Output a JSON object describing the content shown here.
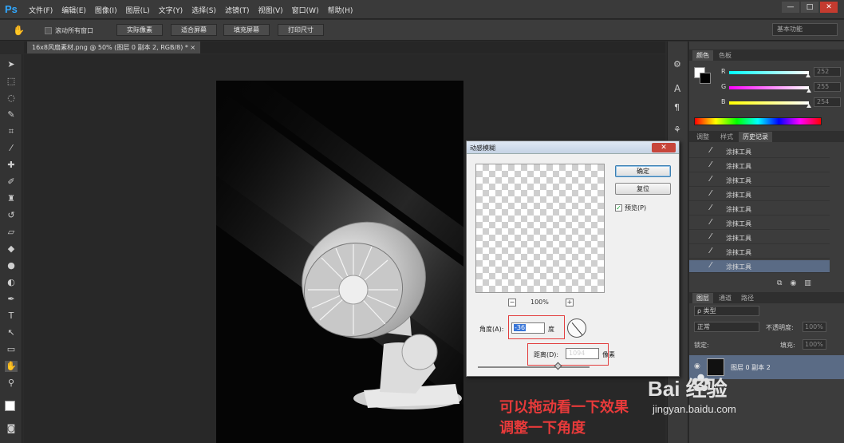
{
  "app": {
    "logo": "Ps"
  },
  "menu": [
    "文件(F)",
    "编辑(E)",
    "图像(I)",
    "图层(L)",
    "文字(Y)",
    "选择(S)",
    "滤镜(T)",
    "视图(V)",
    "窗口(W)",
    "帮助(H)"
  ],
  "window_controls": {
    "minimize": "—",
    "restore": "□",
    "close": "✕"
  },
  "options": {
    "scroll_all": "滚动所有窗口",
    "buttons": [
      "实际像素",
      "适合屏幕",
      "填充屏幕",
      "打印尺寸"
    ],
    "workspace": "基本功能"
  },
  "document_tab": "16x8风扇素材.png @ 50% (图层 0 副本 2, RGB/8) * ×",
  "panels": {
    "color_tabs": [
      "颜色",
      "色板"
    ],
    "sliders": [
      {
        "label": "R",
        "value": "252",
        "color": "#c8d8e8",
        "fill": 0.99
      },
      {
        "label": "G",
        "value": "255",
        "color": "#d6d6d6",
        "fill": 1.0
      },
      {
        "label": "B",
        "value": "254",
        "color": "#e6e6b8",
        "fill": 0.996
      }
    ],
    "history_tabs": [
      "调整",
      "样式",
      "历史记录"
    ],
    "history_items": [
      "涂抹工具",
      "涂抹工具",
      "涂抹工具",
      "涂抹工具",
      "涂抹工具",
      "涂抹工具",
      "涂抹工具",
      "涂抹工具",
      "涂抹工具"
    ],
    "layers_tabs": [
      "图层",
      "通道",
      "路径"
    ],
    "layers_filter": "ρ 类型",
    "blend_mode": "正常",
    "opacity_label": "不透明度:",
    "opacity_value": "100%",
    "lock_label": "锁定:",
    "fill_label": "填充:",
    "fill_value": "100%",
    "layer_name": "图层 0 副本 2"
  },
  "dialog": {
    "title": "动感模糊",
    "close": "✕",
    "ok": "确定",
    "reset": "复位",
    "preview_label": "预览(P)",
    "preview_checked": "✓",
    "zoom": "100%",
    "zoom_minus": "−",
    "zoom_plus": "+",
    "angle_label": "角度(A):",
    "angle_value": "-36",
    "angle_unit": "度",
    "distance_label": "距离(D):",
    "distance_value": "1094",
    "distance_unit": "像素"
  },
  "annotation": [
    "可以拖动看一下效果",
    "调整一下角度"
  ],
  "watermark": {
    "logo": "Bai  经验",
    "url": "jingyan.baidu.com"
  }
}
